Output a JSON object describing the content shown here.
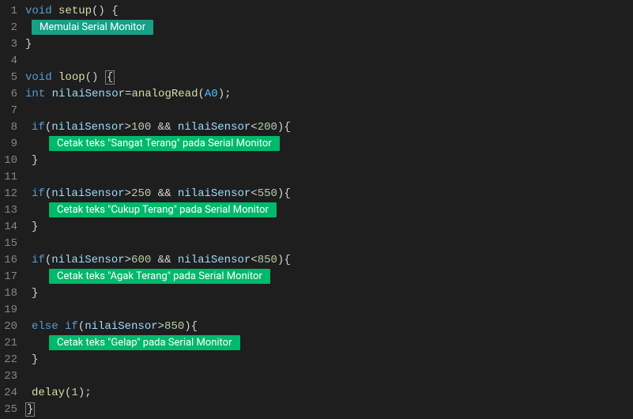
{
  "lineNumbers": [
    "1",
    "2",
    "3",
    "4",
    "5",
    "6",
    "7",
    "8",
    "9",
    "10",
    "11",
    "12",
    "13",
    "14",
    "15",
    "16",
    "17",
    "18",
    "19",
    "20",
    "21",
    "22",
    "23",
    "24",
    "25"
  ],
  "code": {
    "setupSig": {
      "kw": "void",
      "fn": "setup",
      "rest": "() {"
    },
    "block1": "Memulai Serial Monitor",
    "closeBrace": "}",
    "loopSig": {
      "kw": "void",
      "fn": "loop",
      "rest": "() ",
      "brace": "{"
    },
    "declare": {
      "type": "int",
      "var": "nilaiSensor",
      "eq": "=",
      "fn": "analogRead",
      "open": "(",
      "arg": "A0",
      "close": ");"
    },
    "if1": {
      "kw": "if",
      "open": "(",
      "var1": "nilaiSensor",
      "op1": ">",
      "num1": "100",
      "amp": " && ",
      "var2": "nilaiSensor",
      "op2": "<",
      "num2": "200",
      "close": "){"
    },
    "block2": "Cetak teks \"Sangat Terang\" pada Serial Monitor",
    "if2": {
      "kw": "if",
      "open": "(",
      "var1": "nilaiSensor",
      "op1": ">",
      "num1": "250",
      "amp": " && ",
      "var2": "nilaiSensor",
      "op2": "<",
      "num2": "550",
      "close": "){"
    },
    "block3": "Cetak teks \"Cukup Terang\" pada Serial Monitor",
    "if3": {
      "kw": "if",
      "open": "(",
      "var1": "nilaiSensor",
      "op1": ">",
      "num1": "600",
      "amp": " && ",
      "var2": "nilaiSensor",
      "op2": "<",
      "num2": "850",
      "close": "){"
    },
    "block4": "Cetak teks \"Agak Terang\" pada Serial Monitor",
    "elseif": {
      "kw": "else if",
      "open": "(",
      "var1": "nilaiSensor",
      "op1": ">",
      "num1": "850",
      "close": "){"
    },
    "block5": "Cetak teks \"Gelap\" pada Serial Monitor",
    "delay": {
      "fn": "delay",
      "open": "(",
      "num": "1",
      "close": ");"
    },
    "finalClose": "}"
  }
}
